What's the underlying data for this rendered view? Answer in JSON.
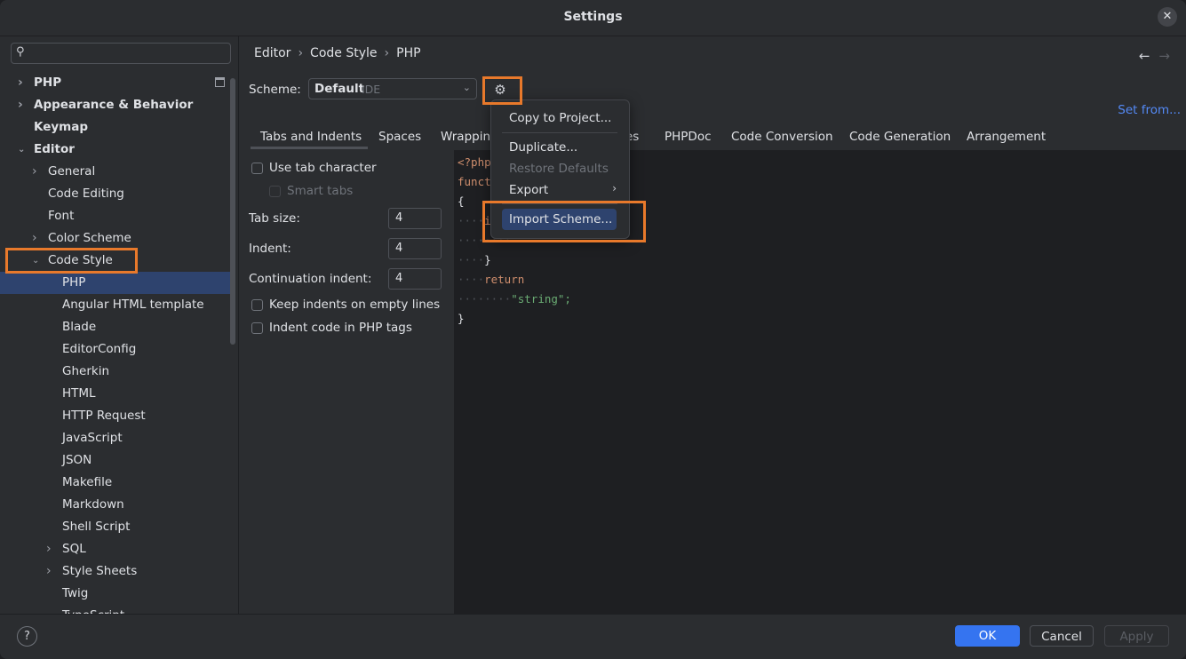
{
  "window": {
    "title": "Settings"
  },
  "sidebar": {
    "search_placeholder": "",
    "items": [
      {
        "label": "PHP",
        "level": 0,
        "chevron": "right",
        "bold": true
      },
      {
        "label": "Appearance & Behavior",
        "level": 0,
        "chevron": "right",
        "bold": true
      },
      {
        "label": "Keymap",
        "level": 0,
        "chevron": "none",
        "bold": true
      },
      {
        "label": "Editor",
        "level": 0,
        "chevron": "down",
        "bold": true
      },
      {
        "label": "General",
        "level": 1,
        "chevron": "right"
      },
      {
        "label": "Code Editing",
        "level": 1,
        "chevron": "none"
      },
      {
        "label": "Font",
        "level": 1,
        "chevron": "none"
      },
      {
        "label": "Color Scheme",
        "level": 1,
        "chevron": "right"
      },
      {
        "label": "Code Style",
        "level": 1,
        "chevron": "down"
      },
      {
        "label": "PHP",
        "level": 2,
        "chevron": "none",
        "selected": true
      },
      {
        "label": "Angular HTML template",
        "level": 2,
        "chevron": "none"
      },
      {
        "label": "Blade",
        "level": 2,
        "chevron": "none"
      },
      {
        "label": "EditorConfig",
        "level": 2,
        "chevron": "none"
      },
      {
        "label": "Gherkin",
        "level": 2,
        "chevron": "none"
      },
      {
        "label": "HTML",
        "level": 2,
        "chevron": "none"
      },
      {
        "label": "HTTP Request",
        "level": 2,
        "chevron": "none"
      },
      {
        "label": "JavaScript",
        "level": 2,
        "chevron": "none"
      },
      {
        "label": "JSON",
        "level": 2,
        "chevron": "none"
      },
      {
        "label": "Makefile",
        "level": 2,
        "chevron": "none"
      },
      {
        "label": "Markdown",
        "level": 2,
        "chevron": "none"
      },
      {
        "label": "Shell Script",
        "level": 2,
        "chevron": "none"
      },
      {
        "label": "SQL",
        "level": 2,
        "chevron": "right"
      },
      {
        "label": "Style Sheets",
        "level": 2,
        "chevron": "right"
      },
      {
        "label": "Twig",
        "level": 2,
        "chevron": "none"
      },
      {
        "label": "TypeScript",
        "level": 2,
        "chevron": "none"
      }
    ]
  },
  "breadcrumb": {
    "part1": "Editor",
    "part2": "Code Style",
    "part3": "PHP",
    "sep": "›"
  },
  "nav": {
    "back": "←",
    "forward": "→"
  },
  "scheme": {
    "label": "Scheme:",
    "value": "Default",
    "sub": "IDE",
    "set_from": "Set from..."
  },
  "tabs": [
    "Tabs and Indents",
    "Spaces",
    "Wrapping",
    "es",
    "PHPDoc",
    "Code Conversion",
    "Code Generation",
    "Arrangement"
  ],
  "options": {
    "use_tab": "Use tab character",
    "smart_tabs": "Smart tabs",
    "tab_size_label": "Tab size:",
    "tab_size": "4",
    "indent_label": "Indent:",
    "indent": "4",
    "cont_label": "Continuation indent:",
    "cont": "4",
    "keep_indents": "Keep indents on empty lines",
    "indent_php": "Indent code in PHP tags"
  },
  "code": {
    "l1": "<?php",
    "l2": "funct",
    "l3": "{",
    "l4_ws": "····",
    "l4": "i",
    "l5_ws": "········",
    "l5": "",
    "l6_ws": "····",
    "l6": "}",
    "l7_ws": "····",
    "l7": "return",
    "l8_ws": "········",
    "l8": "\"string\";",
    "l9": "}"
  },
  "menu": {
    "copy": "Copy to Project...",
    "duplicate": "Duplicate...",
    "restore": "Restore Defaults",
    "export": "Export",
    "import": "Import Scheme..."
  },
  "footer": {
    "help": "?",
    "ok": "OK",
    "cancel": "Cancel",
    "apply": "Apply"
  },
  "colors": {
    "accent": "#3574f0",
    "highlight": "#e8792b",
    "selection": "#2e436e"
  }
}
